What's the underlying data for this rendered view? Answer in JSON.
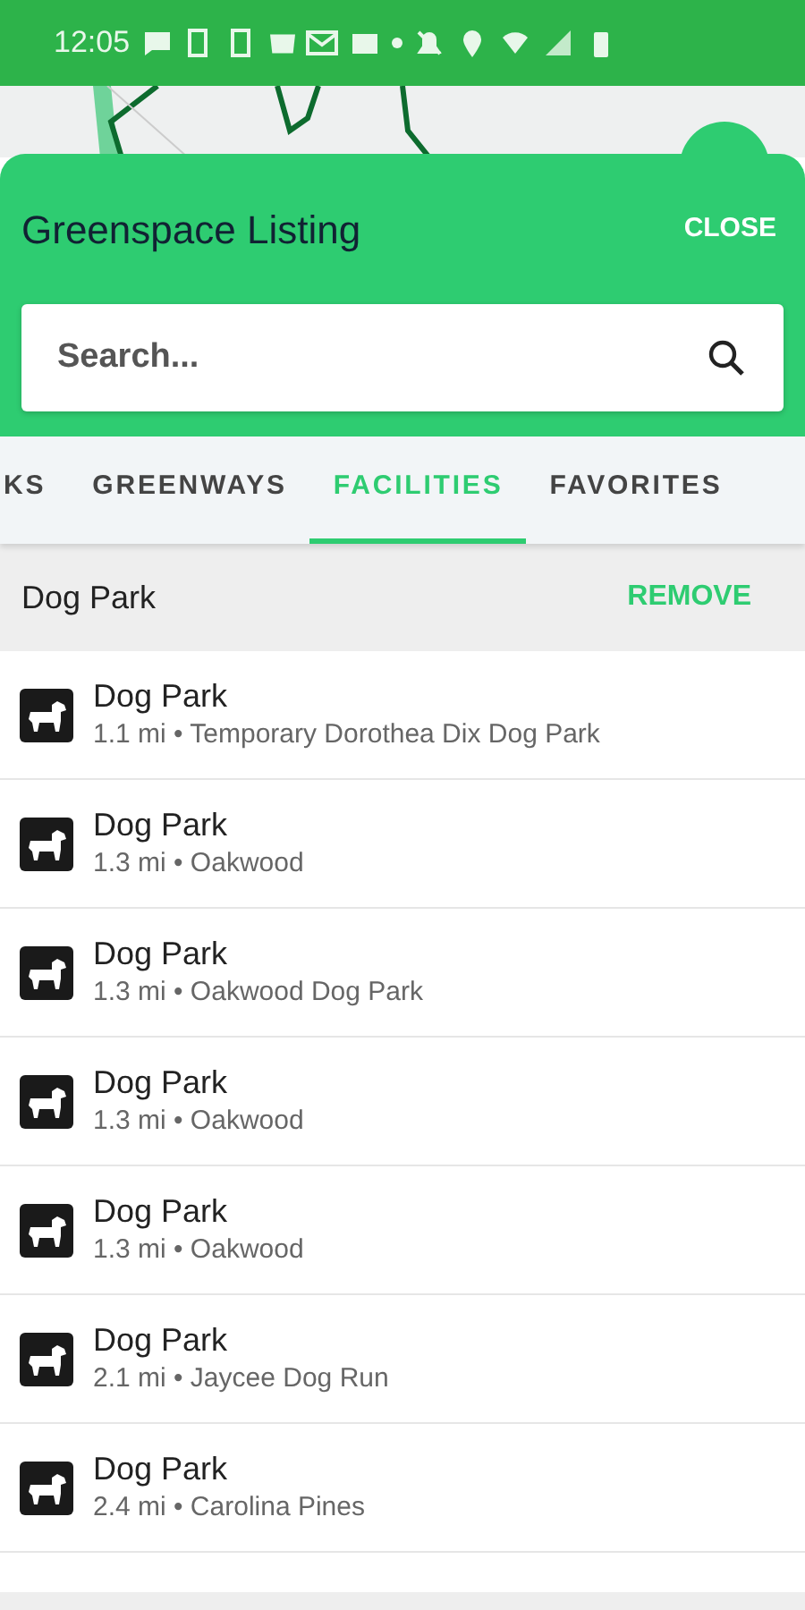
{
  "status_bar": {
    "time": "12:05"
  },
  "panel": {
    "title": "Greenspace Listing",
    "close": "CLOSE",
    "search": {
      "placeholder": "Search..."
    }
  },
  "tabs": [
    {
      "label": "KS",
      "selected": false
    },
    {
      "label": "GREENWAYS",
      "selected": false
    },
    {
      "label": "FACILITIES",
      "selected": true
    },
    {
      "label": "FAVORITES",
      "selected": false
    }
  ],
  "filter": {
    "label": "Dog Park",
    "action": "REMOVE"
  },
  "items": [
    {
      "title": "Dog Park",
      "subtitle": "1.1 mi • Temporary Dorothea Dix Dog Park"
    },
    {
      "title": "Dog Park",
      "subtitle": "1.3 mi • Oakwood"
    },
    {
      "title": "Dog Park",
      "subtitle": "1.3 mi • Oakwood Dog Park"
    },
    {
      "title": "Dog Park",
      "subtitle": "1.3 mi • Oakwood"
    },
    {
      "title": "Dog Park",
      "subtitle": "1.3 mi • Oakwood"
    },
    {
      "title": "Dog Park",
      "subtitle": "2.1 mi • Jaycee Dog Run"
    },
    {
      "title": "Dog Park",
      "subtitle": "2.4 mi • Carolina Pines"
    }
  ]
}
